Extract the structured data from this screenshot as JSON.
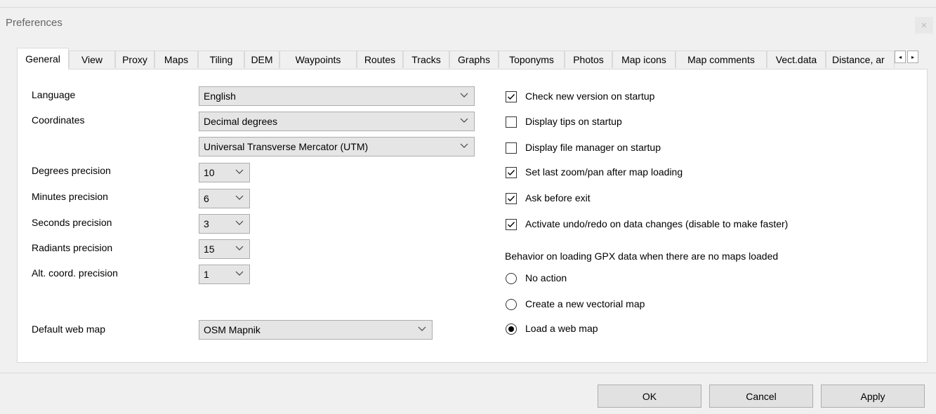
{
  "window": {
    "title": "Preferences",
    "close_glyph": "✕"
  },
  "tabs": [
    {
      "label": "General",
      "active": true
    },
    {
      "label": "View"
    },
    {
      "label": "Proxy"
    },
    {
      "label": "Maps"
    },
    {
      "label": "Tiling"
    },
    {
      "label": "DEM"
    },
    {
      "label": "Waypoints"
    },
    {
      "label": "Routes"
    },
    {
      "label": "Tracks"
    },
    {
      "label": "Graphs"
    },
    {
      "label": "Toponyms"
    },
    {
      "label": "Photos"
    },
    {
      "label": "Map icons"
    },
    {
      "label": "Map comments"
    },
    {
      "label": "Vect.data"
    },
    {
      "label": "Distance, ar"
    }
  ],
  "tab_scroll": {
    "left_glyph": "◂",
    "right_glyph": "▸"
  },
  "general": {
    "language": {
      "label": "Language",
      "value": "English"
    },
    "coordinates": {
      "label": "Coordinates",
      "value": "Decimal degrees",
      "grid_value": "Universal Transverse Mercator (UTM)"
    },
    "precision": [
      {
        "label": "Degrees precision",
        "value": "10"
      },
      {
        "label": "Minutes precision",
        "value": "6"
      },
      {
        "label": "Seconds precision",
        "value": "3"
      },
      {
        "label": "Radiants precision",
        "value": "15"
      },
      {
        "label": "Alt. coord. precision",
        "value": "1"
      }
    ],
    "default_web_map": {
      "label": "Default web map",
      "value": "OSM Mapnik"
    },
    "checkboxes": [
      {
        "label": "Check new version on startup",
        "checked": true
      },
      {
        "label": "Display tips on startup",
        "checked": false
      },
      {
        "label": "Display file manager on startup",
        "checked": false
      },
      {
        "label": "Set last zoom/pan after map loading",
        "checked": true
      },
      {
        "label": "Ask before exit",
        "checked": true
      },
      {
        "label": "Activate undo/redo on data changes (disable to make faster)",
        "checked": true
      }
    ],
    "gpx_behavior": {
      "label": "Behavior on loading GPX data when there are no maps loaded",
      "options": [
        {
          "label": "No action",
          "selected": false
        },
        {
          "label": "Create a new vectorial map",
          "selected": false
        },
        {
          "label": "Load a web map",
          "selected": true
        }
      ]
    }
  },
  "buttons": {
    "ok": "OK",
    "cancel": "Cancel",
    "apply": "Apply"
  },
  "colors": {
    "window_bg": "#f0f0f0",
    "panel_bg": "#ffffff",
    "combo_bg": "#e5e5e5",
    "button_bg": "#e1e1e1"
  }
}
